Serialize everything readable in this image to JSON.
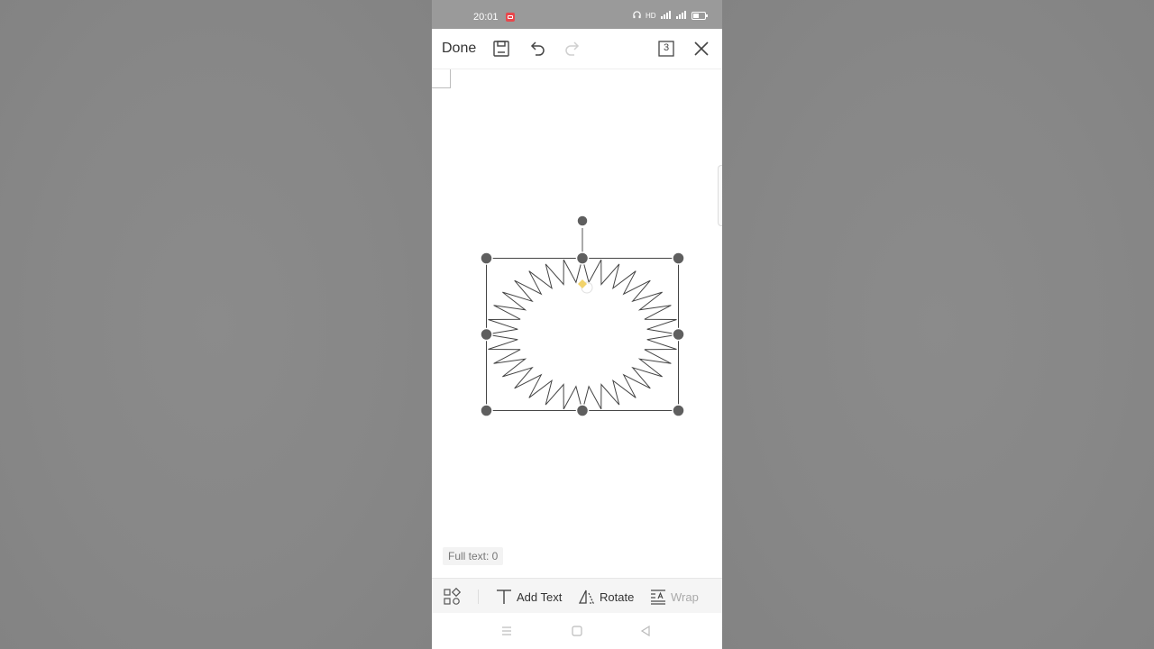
{
  "status_bar": {
    "time": "20:01",
    "icons": [
      "headphones-icon",
      "hd-icon",
      "signal-icon",
      "signal-icon",
      "battery-icon"
    ],
    "record_color": "#e8474c"
  },
  "toolbar": {
    "done_label": "Done",
    "page_count": "3",
    "icons": [
      "save-icon",
      "undo-icon",
      "redo-icon",
      "page-count-icon",
      "close-icon"
    ]
  },
  "canvas": {
    "shape": "32-point star (selected)",
    "handle_color": "#5f5f5f",
    "adjust_handle_color": "#f2d36b"
  },
  "footer": {
    "full_text": "Full text: 0"
  },
  "bottom_bar": {
    "add_text": "Add Text",
    "rotate": "Rotate",
    "wrap": "Wrap"
  }
}
